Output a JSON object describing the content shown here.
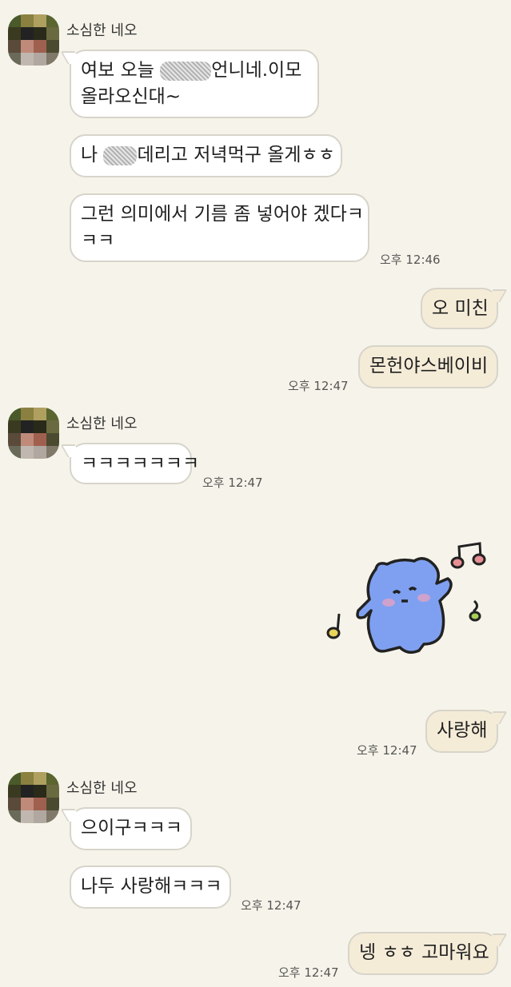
{
  "contact_name": "소심한 네오",
  "messages": {
    "m1_part1": "여보 오늘 ",
    "m1_part2": "언니네.이모",
    "m1_line2": "올라오신대~",
    "m2_part1": "나 ",
    "m2_part2": "데리고 저녁먹구 올게ㅎㅎ",
    "m3_line1": "그런 의미에서 기름 좀 넣어야 겠다ㅋ",
    "m3_line2": "ㅋㅋ",
    "m4": "오 미친",
    "m5": "몬헌야스베이비",
    "m6": "ㅋㅋㅋㅋㅋㅋㅋ",
    "m7": "사랑해",
    "m8": "으이구ㅋㅋㅋ",
    "m9": "나두 사랑해ㅋㅋㅋ",
    "m10": "넹 ㅎㅎ 고마워요"
  },
  "times": {
    "t1": "오후 12:46",
    "t2": "오후 12:47",
    "t3": "오후 12:47",
    "t4": "오후 12:47",
    "t5": "오후 12:47",
    "t6": "오후 12:47"
  },
  "sticker": {
    "icon": "blue-bear-dancing-sticker",
    "colors": {
      "bear": "#7fa0f0",
      "note_pink": "#e88f94",
      "note_yellow": "#e8d35b",
      "note_green": "#a8cf5a"
    }
  },
  "colors": {
    "background": "#f6f4ea",
    "incoming_bubble": "#ffffff",
    "outgoing_bubble": "#f5ecd8",
    "bubble_border": "#d7d4ca"
  }
}
